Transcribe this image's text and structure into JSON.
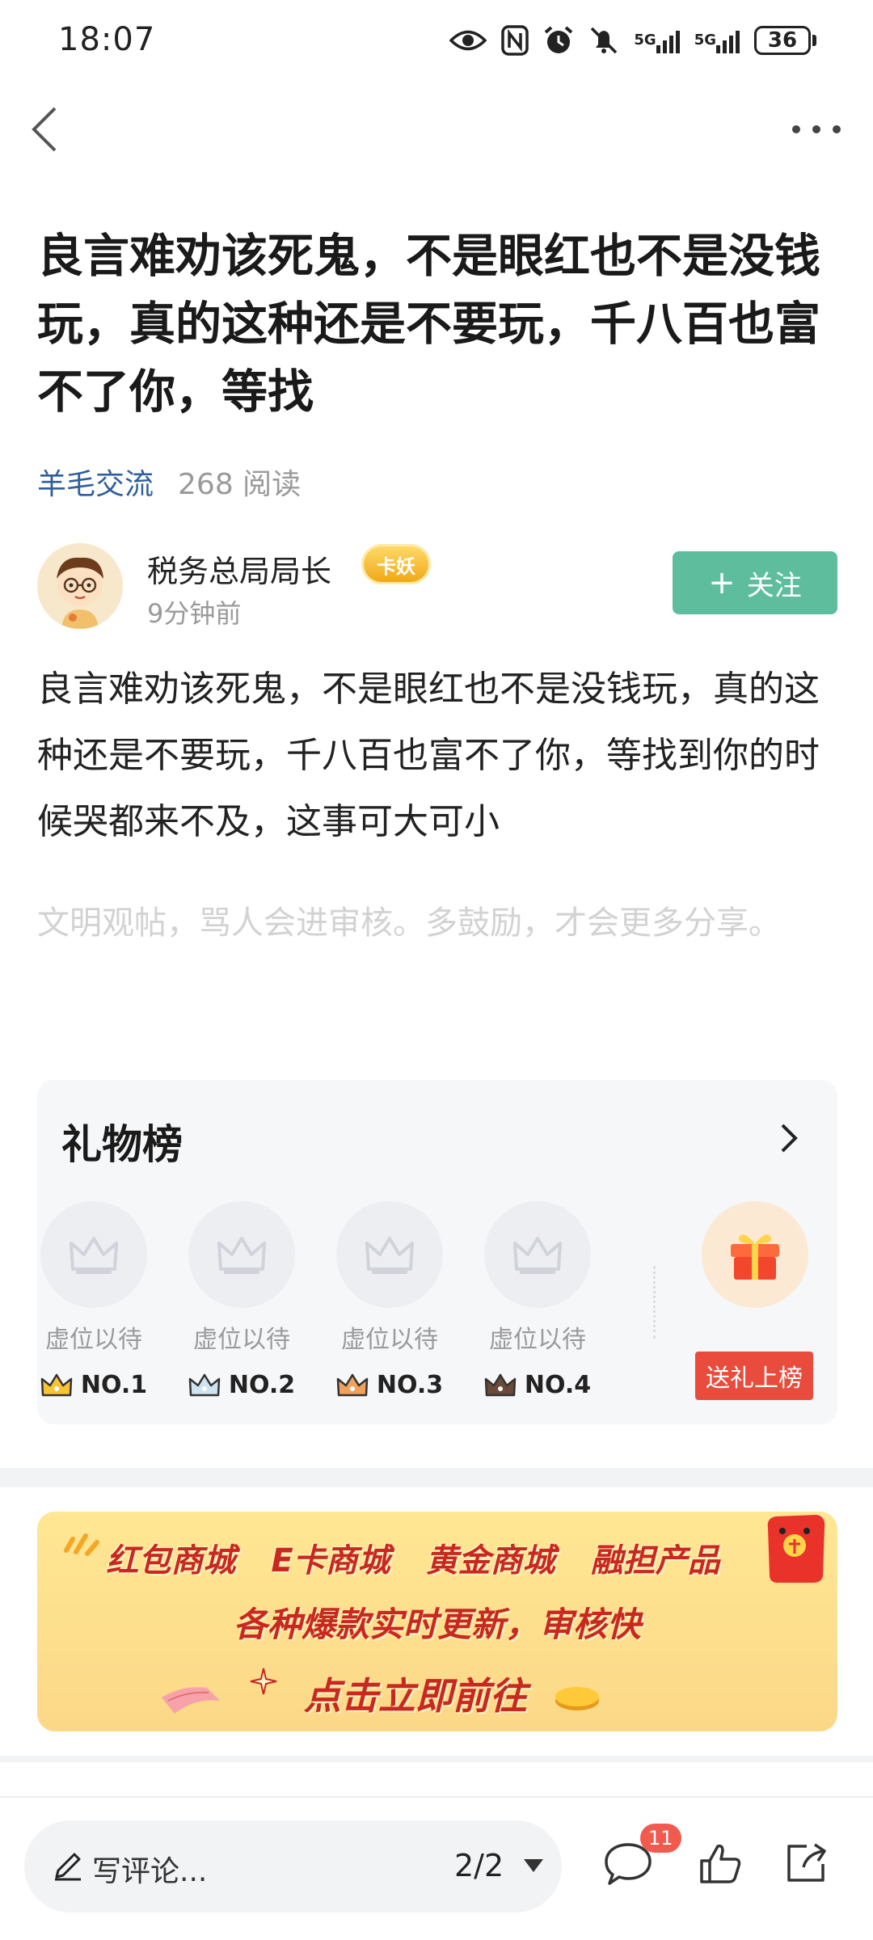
{
  "status": {
    "time": "18:07",
    "net1": "5G",
    "net2": "5G",
    "battery": "36"
  },
  "post": {
    "title": "良言难劝该死鬼，不是眼红也不是没钱玩，真的这种还是不要玩，千八百也富不了你，等找",
    "forum": "羊毛交流",
    "reads": "268 阅读",
    "author": "税务总局局长",
    "badge": "卡妖",
    "time": "9分钟前",
    "follow_label": "关注",
    "body": "良言难劝该死鬼，不是眼红也不是没钱玩，真的这种还是不要玩，千八百也富不了你，等找到你的时候哭都来不及，这事可大可小",
    "notice": "文明观帖，骂人会进审核。多鼓励，才会更多分享。"
  },
  "gift_board": {
    "title": "礼物榜",
    "slots": [
      {
        "label": "虚位以待",
        "rank": "NO.1"
      },
      {
        "label": "虚位以待",
        "rank": "NO.2"
      },
      {
        "label": "虚位以待",
        "rank": "NO.3"
      },
      {
        "label": "虚位以待",
        "rank": "NO.4"
      }
    ],
    "send_label": "送礼上榜"
  },
  "banner": {
    "items": [
      "红包商城",
      "E卡商城",
      "黄金商城",
      "融担产品"
    ],
    "subtitle": "各种爆款实时更新，审核快",
    "cta": "点击立即前往"
  },
  "bottom_bar": {
    "comment_placeholder": "写评论...",
    "page": "2/2",
    "comment_count": "11"
  },
  "colors": {
    "accent_green": "#5dbd9c",
    "forum_link": "#2f5e9c",
    "send_red": "#e94b3c",
    "banner_text": "#c8281e",
    "badge_red": "#f25a4f"
  }
}
